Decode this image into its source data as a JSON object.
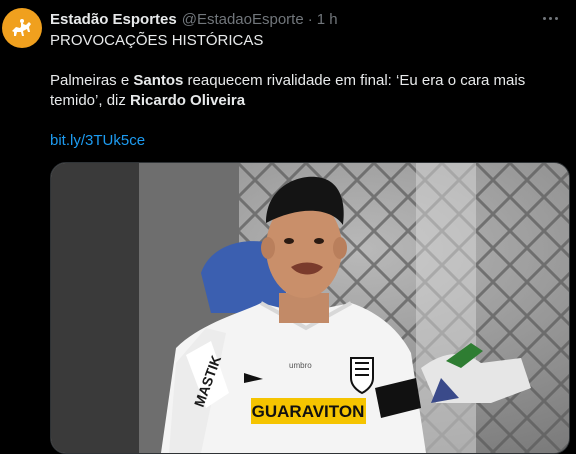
{
  "tweet": {
    "author_name": "Estadão Esportes",
    "handle": "@EstadaoEsporte",
    "separator": "·",
    "time": "1 h",
    "line1": "PROVOCAÇÕES HISTÓRICAS",
    "body": {
      "t1": "Palmeiras e ",
      "b1": "Santos",
      "t2": " reaquecem rivalidade em final: ‘Eu era o cara mais temido’, diz ",
      "b2": "Ricardo Oliveira"
    },
    "link": "bit.ly/3TUk5ce",
    "image": {
      "sponsor_text": "GUARAVITON",
      "sleeve_text": "MASTIK",
      "brand_text": "umbro"
    }
  },
  "icons": {
    "avatar": "horse-rider-logo",
    "more": "more-options-icon"
  },
  "colors": {
    "accent": "#f0a01e",
    "link": "#1d9bf0",
    "muted": "#71767b"
  }
}
